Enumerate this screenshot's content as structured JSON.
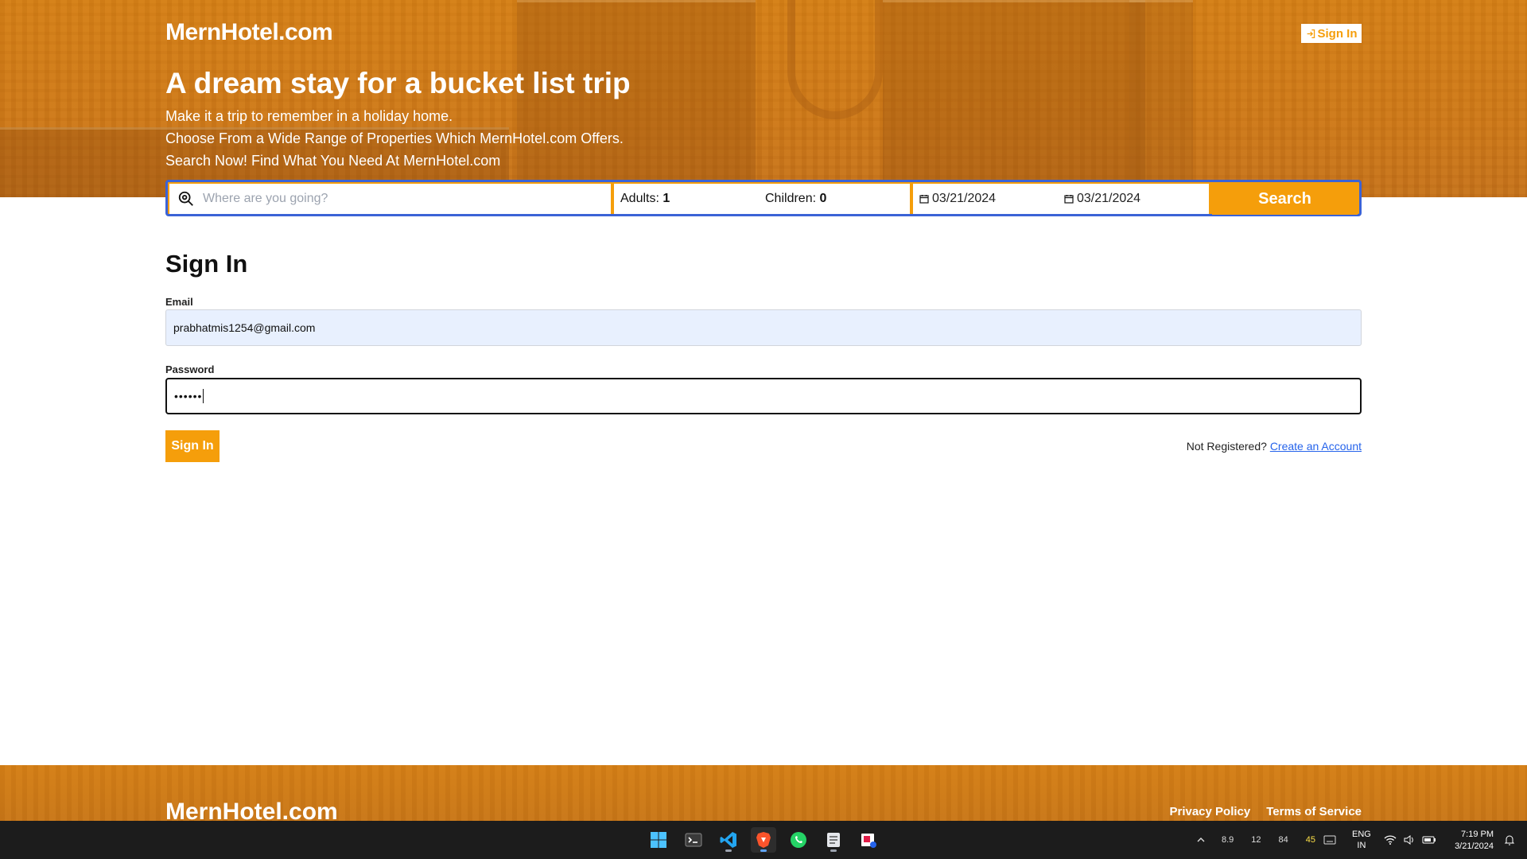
{
  "header": {
    "logo": "MernHotel.com",
    "sign_in_label": "Sign In",
    "headline": "A dream stay for a bucket list trip",
    "sublines": [
      "Make it a trip to remember in a holiday home.",
      "Choose From a Wide Range of Properties Which MernHotel.com Offers.",
      "Search Now! Find What You Need At MernHotel.com"
    ]
  },
  "search": {
    "destination_placeholder": "Where are you going?",
    "adults_label": "Adults:",
    "adults_value": "1",
    "children_label": "Children:",
    "children_value": "0",
    "check_in": "03/21/2024",
    "check_out": "03/21/2024",
    "search_label": "Search"
  },
  "form": {
    "title": "Sign In",
    "email_label": "Email",
    "email_value": "prabhatmis1254@gmail.com",
    "password_label": "Password",
    "password_value": "••••••",
    "submit_label": "Sign In",
    "not_registered": "Not Registered?",
    "create_account": "Create an Account"
  },
  "footer": {
    "logo": "MernHotel.com",
    "links": [
      "Privacy Policy",
      "Terms of Service"
    ]
  },
  "taskbar": {
    "apps": [
      "windows-start",
      "terminal",
      "vscode",
      "brave",
      "whatsapp",
      "notepad",
      "snipping-tool"
    ],
    "tray_values": [
      "8.9",
      "12",
      "84",
      "45"
    ],
    "language": "ENG",
    "region": "IN",
    "time": "7:19 PM",
    "date": "3/21/2024"
  },
  "colors": {
    "accent": "#f59e0b",
    "search_border": "#3b63d6",
    "link": "#2563eb",
    "email_field_bg": "#e8f0fe"
  }
}
